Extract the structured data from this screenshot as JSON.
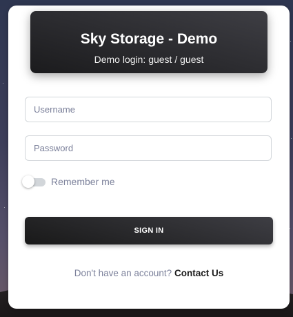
{
  "header": {
    "title": "Sky Storage - Demo",
    "subtitle": "Demo login: guest / guest"
  },
  "form": {
    "username_placeholder": "Username",
    "password_placeholder": "Password",
    "remember_label": "Remember me",
    "remember_checked": false,
    "signin_label": "SIGN IN"
  },
  "footer": {
    "prompt": "Don't have an account?",
    "link_label": "Contact Us"
  },
  "colors": {
    "header_gradient_start": "#3e3e44",
    "header_gradient_end": "#1b1b1d",
    "muted_text": "#7b809a",
    "input_border": "#d2d6da"
  }
}
